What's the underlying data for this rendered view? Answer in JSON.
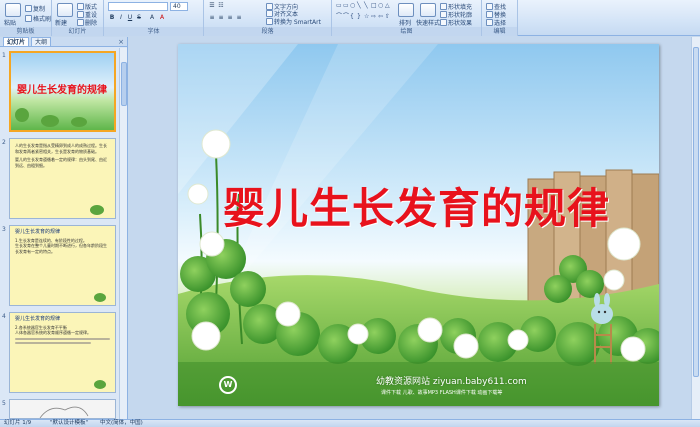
{
  "ribbon": {
    "groups": [
      {
        "label": "剪贴板"
      },
      {
        "label": "幻灯片"
      },
      {
        "label": "字体"
      },
      {
        "label": "段落"
      },
      {
        "label": "绘图"
      },
      {
        "label": "编辑"
      }
    ],
    "clipboard": {
      "paste": "粘贴",
      "copy": "复制",
      "format_painter": "格式刷"
    },
    "slides": {
      "new_slide": "新建\n幻灯片",
      "layout": "版式",
      "reset": "重设",
      "delete": "删除"
    },
    "font": {
      "size": "40"
    },
    "paragraph": {
      "text_direction": "文字方向",
      "align_text": "对齐文本",
      "convert_smartart": "转换为 SmartArt"
    },
    "drawing": {
      "arrange": "排列",
      "quick_styles": "快速样式",
      "shape_fill": "形状填充",
      "shape_outline": "形状轮廓",
      "shape_effects": "形状效果"
    },
    "editing": {
      "find": "查找",
      "replace": "替换",
      "select": "选择"
    }
  },
  "left_panel": {
    "tabs": [
      "幻灯片",
      "大纲"
    ],
    "close": "×",
    "thumbnails": [
      {
        "number": "1",
        "title": "婴儿生长发育的规律"
      },
      {
        "number": "2",
        "bullets": [
          "人的生长发育是指从受精卵到成人的成熟过程。生长和发育两者紧密相关，生长是发育的物质基础。",
          "婴儿的生长发育遵循着一定的规律：由头到尾、由近到远、由粗到细。"
        ]
      },
      {
        "number": "3",
        "heading": "婴儿生长发育的规律",
        "bullets": [
          "1.生长发育是连续的、有阶段性的过程。",
          "生长发育在整个儿童时期不断进行，但各年龄阶段生长发育有一定的特点。"
        ]
      },
      {
        "number": "4",
        "heading": "婴儿生长发育的规律",
        "bullets": [
          "2.各系统器官生长发育不平衡",
          "人体各器官系统的发育顺序遵循一定规律。"
        ]
      },
      {
        "number": "5"
      }
    ]
  },
  "slide": {
    "title": "婴儿生长发育的规律",
    "site_title": "幼教资源网站  ziyuan.baby611.com",
    "site_links": "课件下载  儿歌、故事MP3  FLASH课件下载  动画下载等"
  },
  "statusbar": {
    "slide_counter": "幻灯片 1/9",
    "theme": "\"默认设计模板\"",
    "language": "中文(简体，中国)"
  },
  "colors": {
    "title_red": "#e8121c",
    "ribbon_blue": "#d4e4f7",
    "thumb_yellow": "#fbf5b8",
    "selection_orange": "#f5a623"
  }
}
